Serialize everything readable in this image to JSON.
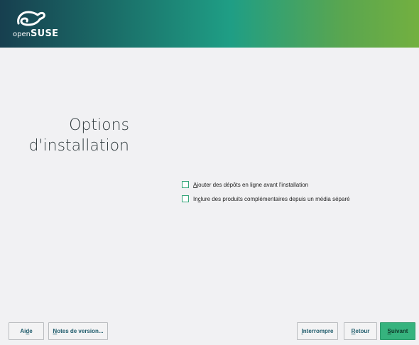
{
  "header": {
    "logo": {
      "icon": "opensuse-chameleon-icon",
      "text_open": "open",
      "text_suse": "SUSE"
    }
  },
  "page": {
    "title": "Options\nd'installation"
  },
  "options": [
    {
      "label_first": "A",
      "label_rest": "jouter des dépôts en ligne avant l'installation",
      "checked": false
    },
    {
      "label_first": "In",
      "label_underline": "c",
      "label_rest": "lure des produits complémentaires depuis un média séparé",
      "checked": false
    }
  ],
  "buttons": {
    "help": {
      "pre": "Ai",
      "u": "d",
      "post": "e"
    },
    "release_notes": {
      "pre": "",
      "u": "N",
      "post": "otes de version..."
    },
    "abort": {
      "pre": "",
      "u": "I",
      "post": "nterrompre"
    },
    "back": {
      "pre": "",
      "u": "R",
      "post": "etour"
    },
    "next": {
      "pre": "",
      "u": "S",
      "post": "uivant"
    }
  },
  "colors": {
    "header_gradient_start": "#173f4f",
    "header_gradient_mid": "#1f9e85",
    "header_gradient_end": "#73b040",
    "accent_green": "#36b37e",
    "button_text": "#215d6d"
  }
}
